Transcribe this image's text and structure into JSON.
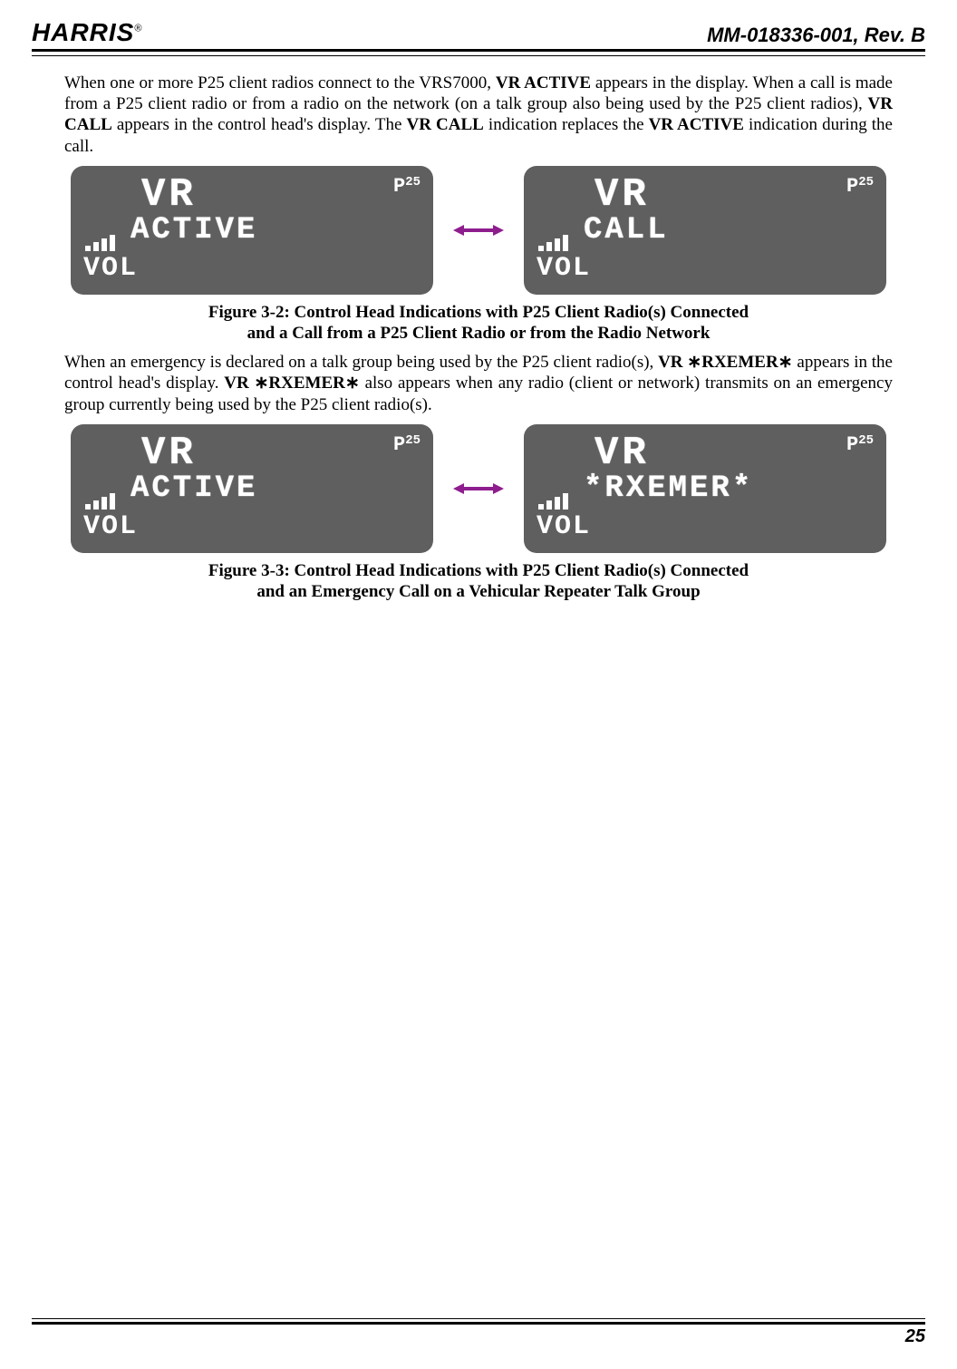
{
  "header": {
    "brand": "HARRIS",
    "doc_id": "MM-018336-001, Rev. B"
  },
  "para1_pre": "When one or more P25 client radios connect to the VRS7000, ",
  "para1_b1": "VR ACTIVE",
  "para1_mid1": " appears in the display. When a call is made from a P25 client radio or from a radio on the network (on a talk group also being used by the P25 client radios), ",
  "para1_b2": "VR CALL",
  "para1_mid2": " appears in the control head's display. The ",
  "para1_b3": "VR CALL",
  "para1_mid3": " indication replaces the ",
  "para1_b4": "VR ACTIVE",
  "para1_end": " indication during the call.",
  "lcd": {
    "vr": "VR",
    "active": "ACTIVE",
    "call": "CALL",
    "rxemer": "*RXEMER*",
    "vol": "VOL",
    "p25_p": "P",
    "p25_25": "25"
  },
  "caption1_l1": "Figure 3-2:  Control Head Indications with P25 Client Radio(s) Connected",
  "caption1_l2": "and a Call from a P25 Client Radio or from the Radio Network",
  "para2_pre": "When an emergency is declared on a talk group being used by the P25 client radio(s), ",
  "para2_b1": "VR ∗RXEMER∗",
  "para2_mid1": " appears in the control head's display. ",
  "para2_b2": "VR ∗RXEMER∗",
  "para2_end": " also appears when any radio (client or network) transmits on an emergency group currently being used by the P25 client radio(s).",
  "caption2_l1": "Figure 3-3:  Control Head Indications with P25 Client Radio(s) Connected",
  "caption2_l2": "and an Emergency Call on a Vehicular Repeater Talk Group",
  "page_number": "25"
}
